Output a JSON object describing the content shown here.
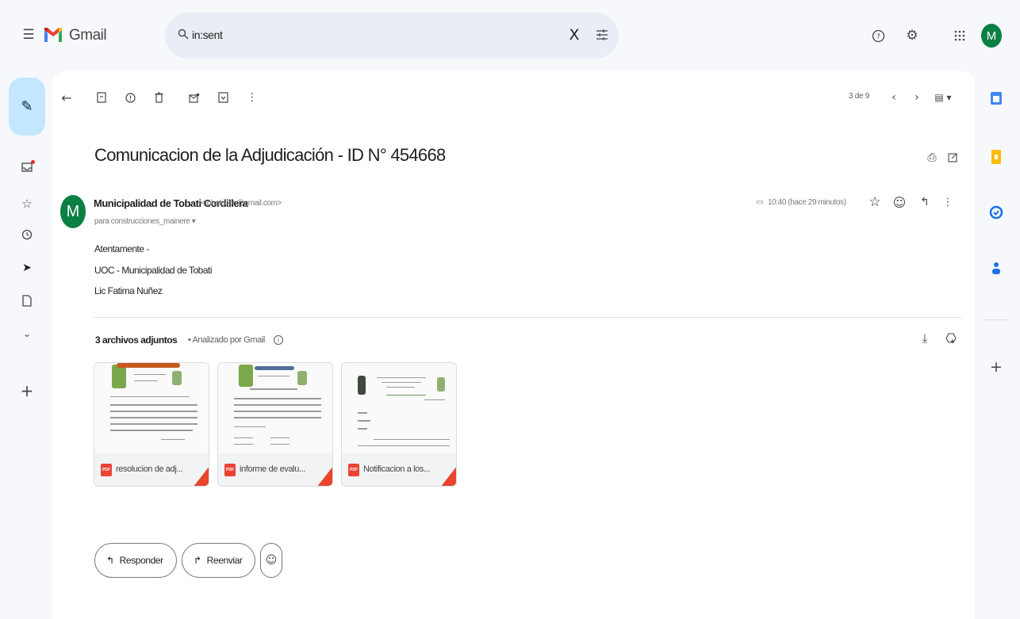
{
  "app": {
    "name": "Gmail"
  },
  "search": {
    "query": "in:sent"
  },
  "account": {
    "initial": "M"
  },
  "colors": {
    "accent": "#0b8043",
    "compose_bg": "#c2e7ff",
    "pdf_red": "#ea4335"
  },
  "icons": {
    "menu": "menu-icon",
    "search": "search-icon",
    "clear": "close-icon",
    "options": "tune-icon",
    "help": "help-icon",
    "settings": "gear-icon",
    "apps": "apps-grid-icon"
  },
  "toolbar": {
    "pager": "3 de 9"
  },
  "message": {
    "subject": "Comunicacion de la Adjudicación - ID N° 454668",
    "sender_initial": "M",
    "sender_name": "Municipalidad de Tobati Cordillera",
    "sender_email": "<tobati.uoc@gmail.com>",
    "recipients": "para construcciones_mainere ▾",
    "time": "10:40 (hace 29 minutos)",
    "body": [
      "Atentamente -",
      "UOC - Municipalidad de Tobati",
      "Lic Fatima Nuñez"
    ]
  },
  "attachments": {
    "count_label": "3 archivos adjuntos",
    "scan_label": "• Analizado por Gmail",
    "items": [
      {
        "badge": "PDF",
        "name": "resolucion de adj..."
      },
      {
        "badge": "PDF",
        "name": "informe de evalu..."
      },
      {
        "badge": "PDF",
        "name": "Notificacion a los..."
      }
    ]
  },
  "actions": {
    "reply_label": "Responder",
    "forward_label": "Reenviar"
  }
}
